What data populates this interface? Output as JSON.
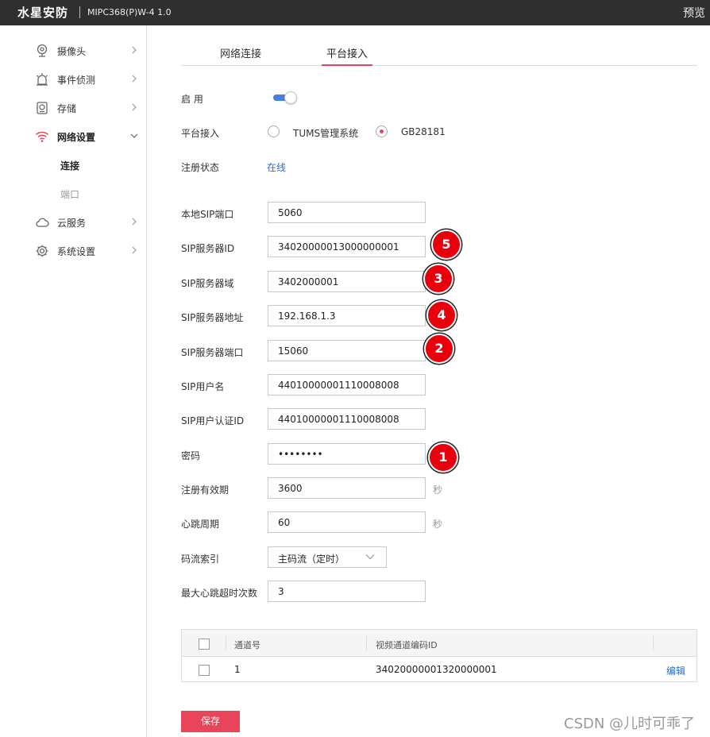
{
  "topbar": {
    "brand": "水星安防",
    "model": "MIPC368(P)W-4 1.0",
    "preview": "预览"
  },
  "sidebar": {
    "items": [
      {
        "label": "摄像头"
      },
      {
        "label": "事件侦测"
      },
      {
        "label": "存储"
      },
      {
        "label": "网络设置"
      },
      {
        "label": "云服务"
      },
      {
        "label": "系统设置"
      }
    ],
    "subitems": [
      {
        "label": "连接"
      },
      {
        "label": "端口"
      }
    ]
  },
  "tabs": [
    {
      "label": "网络连接"
    },
    {
      "label": "平台接入"
    }
  ],
  "form": {
    "enable_label": "启 用",
    "platform_label": "平台接入",
    "platform_options": [
      "TUMS管理系统",
      "GB28181"
    ],
    "platform_selected": "GB28181",
    "reg_status_label": "注册状态",
    "reg_status_value": "在线",
    "local_sip_port_label": "本地SIP端口",
    "local_sip_port": "5060",
    "sip_server_id_label": "SIP服务器ID",
    "sip_server_id": "34020000013000000001",
    "sip_server_domain_label": "SIP服务器域",
    "sip_server_domain": "3402000001",
    "sip_server_addr_label": "SIP服务器地址",
    "sip_server_addr": "192.168.1.3",
    "sip_server_port_label": "SIP服务器端口",
    "sip_server_port": "15060",
    "sip_username_label": "SIP用户名",
    "sip_username": "44010000001110008008",
    "sip_auth_id_label": "SIP用户认证ID",
    "sip_auth_id": "44010000001110008008",
    "password_label": "密码",
    "password": "••••••••",
    "reg_validity_label": "注册有效期",
    "reg_validity": "3600",
    "heartbeat_label": "心跳周期",
    "heartbeat": "60",
    "unit_seconds": "秒",
    "stream_index_label": "码流索引",
    "stream_index": "主码流（定时）",
    "max_heartbeat_timeout_label": "最大心跳超时次数",
    "max_heartbeat_timeout": "3"
  },
  "badges": [
    "5",
    "3",
    "4",
    "2",
    "1"
  ],
  "table": {
    "headers": [
      "通道号",
      "视频通道编码ID"
    ],
    "rows": [
      {
        "channel": "1",
        "code_id": "34020000001320000001",
        "action": "编辑"
      }
    ]
  },
  "save_label": "保存",
  "watermark": "CSDN @儿时可乖了",
  "colors": {
    "accent": "#e8445a",
    "link": "#2a6cc8",
    "toggle": "#4a7fdc",
    "badge": "#e8000c",
    "topbar": "#2f2f2f"
  }
}
